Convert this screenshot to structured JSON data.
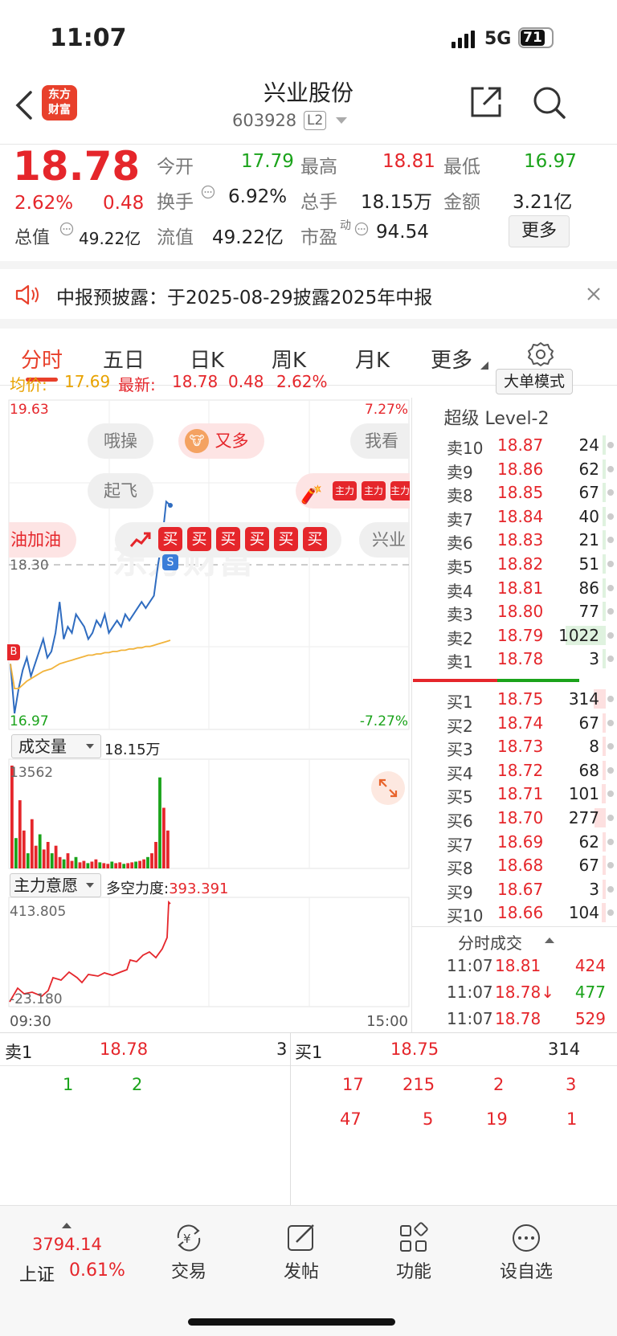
{
  "status": {
    "time": "11:07",
    "network": "5G",
    "battery": "71"
  },
  "header": {
    "title": "兴业股份",
    "code": "603928",
    "level": "L2",
    "logo_line1": "东方",
    "logo_line2": "财富"
  },
  "quote": {
    "price": "18.78",
    "pct": "2.62%",
    "chg": "0.48",
    "mv_label": "总值",
    "mv": "49.22亿",
    "open_label": "今开",
    "open": "17.79",
    "high_label": "最高",
    "high": "18.81",
    "low_label": "最低",
    "low": "16.97",
    "turn_label": "换手",
    "turn": "6.92%",
    "vol_label": "总手",
    "vol": "18.15万",
    "amt_label": "金额",
    "amt": "3.21亿",
    "float_label": "流值",
    "float": "49.22亿",
    "pe_label": "市盈",
    "pe_sup": "动",
    "pe": "94.54",
    "more": "更多"
  },
  "notice": {
    "text": "中报预披露：于2025-08-29披露2025年中报"
  },
  "tabs": [
    "分时",
    "五日",
    "日K",
    "周K",
    "月K",
    "更多"
  ],
  "info_bar": {
    "avg_label": "均价:",
    "avg": "17.69",
    "last_label": "最新:",
    "last": "18.78",
    "chg": "0.48",
    "pct": "2.62%",
    "mode_button": "大单模式"
  },
  "chart": {
    "y_top": "19.63",
    "y_bottom": "16.97",
    "y_mid": "18.30",
    "pct_top": "7.27%",
    "pct_bottom": "-7.27%",
    "comments": [
      "哦操",
      "又多",
      "我看有",
      "起飞",
      "油加油",
      "兴业"
    ],
    "buy_badge": "买",
    "strong_badge": "主力",
    "b_marker": "B",
    "s_marker": "S",
    "vol_label": "成交量",
    "vol_total": "18.15万",
    "vol_max": "13562",
    "ind_label": "主力意愿",
    "ind_name": "多空力度:",
    "ind_value": "393.391",
    "ind_top": "413.805",
    "ind_bottom": "-23.180",
    "time_start": "09:30",
    "time_end": "15:00",
    "watermark": "东方财富"
  },
  "chart_data": {
    "type": "line",
    "series": [
      {
        "values": [
          17.5,
          17.1,
          17.3,
          17.45,
          17.55,
          17.4,
          17.5,
          17.6,
          17.7,
          17.55,
          17.6,
          17.75,
          18.0,
          17.7,
          17.8,
          17.75,
          17.9,
          17.85,
          17.8,
          17.7,
          17.75,
          17.85,
          17.8,
          17.9,
          17.75,
          17.8,
          17.85,
          17.8,
          17.9,
          17.85,
          17.9,
          17.95,
          18.0,
          17.95,
          18.0,
          18.05,
          18.3,
          18.5,
          18.81,
          18.78
        ]
      },
      {
        "values": [
          17.5,
          17.3,
          17.3,
          17.33,
          17.36,
          17.38,
          17.4,
          17.42,
          17.44,
          17.45,
          17.46,
          17.48,
          17.5,
          17.51,
          17.52,
          17.53,
          17.54,
          17.55,
          17.56,
          17.57,
          17.57,
          17.58,
          17.58,
          17.59,
          17.59,
          17.6,
          17.6,
          17.61,
          17.61,
          17.62,
          17.62,
          17.63,
          17.63,
          17.64,
          17.64,
          17.65,
          17.66,
          17.67,
          17.68,
          17.69
        ]
      }
    ],
    "ylim": [
      16.97,
      19.63
    ],
    "volume": [
      13562,
      4000,
      9000,
      5000,
      2000,
      6500,
      3000,
      4500,
      2500,
      3500,
      2000,
      3000,
      1500,
      1200,
      2000,
      1000,
      1500,
      800,
      1000,
      700,
      900,
      1200,
      800,
      700,
      600,
      900,
      700,
      800,
      600,
      700,
      800,
      900,
      1000,
      1200,
      1500,
      2000,
      3500,
      12000,
      8000,
      5000
    ]
  },
  "orderbook": {
    "title": "超级 Level-2",
    "asks": [
      {
        "label": "卖10",
        "price": "18.87",
        "vol": "24"
      },
      {
        "label": "卖9",
        "price": "18.86",
        "vol": "62"
      },
      {
        "label": "卖8",
        "price": "18.85",
        "vol": "67"
      },
      {
        "label": "卖7",
        "price": "18.84",
        "vol": "40"
      },
      {
        "label": "卖6",
        "price": "18.83",
        "vol": "21"
      },
      {
        "label": "卖5",
        "price": "18.82",
        "vol": "51"
      },
      {
        "label": "卖4",
        "price": "18.81",
        "vol": "86"
      },
      {
        "label": "卖3",
        "price": "18.80",
        "vol": "77"
      },
      {
        "label": "卖2",
        "price": "18.79",
        "vol": "1022"
      },
      {
        "label": "卖1",
        "price": "18.78",
        "vol": "3"
      }
    ],
    "bids": [
      {
        "label": "买1",
        "price": "18.75",
        "vol": "314"
      },
      {
        "label": "买2",
        "price": "18.74",
        "vol": "67"
      },
      {
        "label": "买3",
        "price": "18.73",
        "vol": "8"
      },
      {
        "label": "买4",
        "price": "18.72",
        "vol": "68"
      },
      {
        "label": "买5",
        "price": "18.71",
        "vol": "101"
      },
      {
        "label": "买6",
        "price": "18.70",
        "vol": "277"
      },
      {
        "label": "买7",
        "price": "18.69",
        "vol": "62"
      },
      {
        "label": "买8",
        "price": "18.68",
        "vol": "67"
      },
      {
        "label": "买9",
        "price": "18.67",
        "vol": "3"
      },
      {
        "label": "买10",
        "price": "18.66",
        "vol": "104"
      }
    ],
    "trades_title": "分时成交",
    "trades": [
      {
        "time": "11:07",
        "price": "18.81",
        "vol": "424"
      },
      {
        "time": "11:07",
        "price": "18.78↓",
        "vol": "477"
      },
      {
        "time": "11:07",
        "price": "18.78",
        "vol": "529"
      }
    ]
  },
  "queue": {
    "sell_label": "卖1",
    "sell_price": "18.78",
    "sell_count": "3",
    "sell_orders": [
      "1",
      "2"
    ],
    "buy_label": "买1",
    "buy_price": "18.75",
    "buy_count": "314",
    "buy_orders_row1": [
      "17",
      "215",
      "2",
      "3"
    ],
    "buy_orders_row2": [
      "47",
      "5",
      "19",
      "1"
    ]
  },
  "bottom_nav": {
    "index_value": "3794.14",
    "index_name": "上证",
    "index_pct": "0.61%",
    "items": [
      "交易",
      "发帖",
      "功能",
      "设自选"
    ]
  }
}
